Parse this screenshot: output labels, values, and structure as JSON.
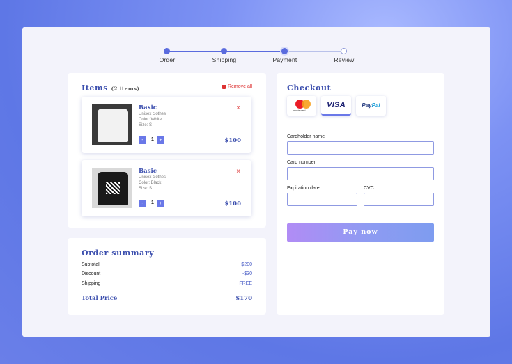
{
  "stepper": {
    "steps": [
      {
        "label": "Order",
        "state": "done"
      },
      {
        "label": "Shipping",
        "state": "done"
      },
      {
        "label": "Payment",
        "state": "current"
      },
      {
        "label": "Review",
        "state": "pending"
      }
    ]
  },
  "items_panel": {
    "title": "Items",
    "count_label": "(2 items)",
    "remove_all_label": "Remove all",
    "remove_icon": "trash-icon",
    "items": [
      {
        "name": "Basic",
        "category": "Unisex clothes",
        "color": "Color: White",
        "size": "Size: S",
        "qty": "1",
        "minus": "-",
        "plus": "+",
        "price": "$100",
        "remove": "×",
        "image": "white-tshirt"
      },
      {
        "name": "Basic",
        "category": "Unisex clothes",
        "color": "Color: Black",
        "size": "Size: S",
        "qty": "1",
        "minus": "-",
        "plus": "+",
        "price": "$100",
        "remove": "×",
        "image": "black-tshirt"
      }
    ]
  },
  "summary": {
    "title": "Order summary",
    "rows": [
      {
        "label": "Subtotal",
        "value": "$200"
      },
      {
        "label": "Discount",
        "value": "-$30"
      },
      {
        "label": "Shipping",
        "value": "FREE"
      }
    ],
    "total_label": "Total Price",
    "total_value": "$170"
  },
  "checkout": {
    "title": "Checkout",
    "methods": [
      {
        "name": "mastercard",
        "text": "mastercard"
      },
      {
        "name": "visa",
        "text": "VISA",
        "selected": true
      },
      {
        "name": "paypal",
        "text1": "Pay",
        "text2": "Pal"
      }
    ],
    "fields": {
      "cardholder_label": "Cardholder name",
      "card_number_label": "Card number",
      "expiration_label": "Expiration date",
      "cvc_label": "CVC"
    },
    "pay_button": "Pay now"
  },
  "colors": {
    "accent": "#5a6bde",
    "heading": "#3c4fae",
    "danger": "#dd3333"
  }
}
